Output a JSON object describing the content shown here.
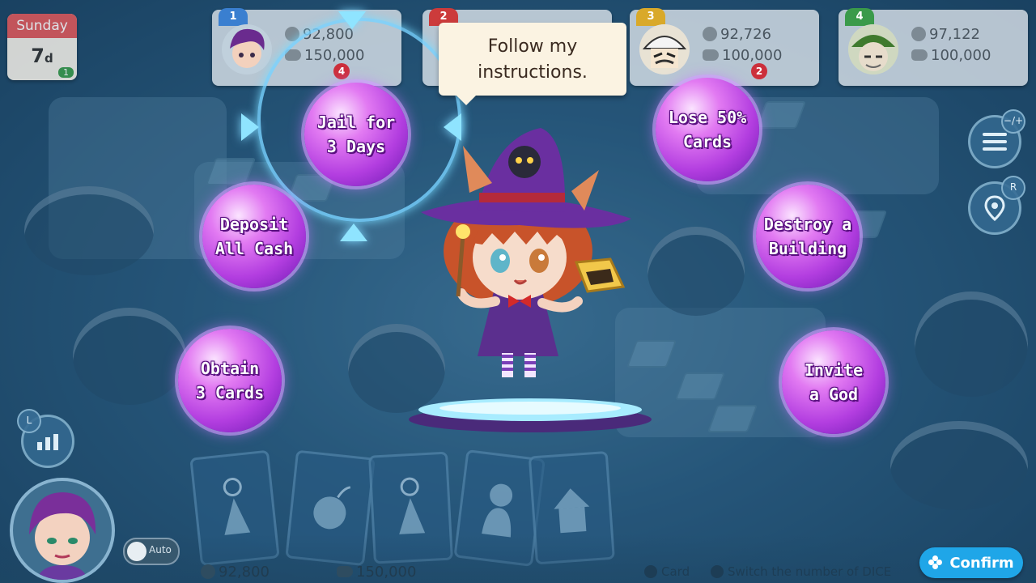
{
  "day": {
    "name": "Sunday",
    "number": "7",
    "unit": "d",
    "badge": "1"
  },
  "players": [
    {
      "rank": "1",
      "cash": "92,800",
      "assets": "150,000",
      "rank_color": "#3a7fd0",
      "dice": "4"
    },
    {
      "rank": "2",
      "cash": "",
      "assets": "",
      "rank_color": "#cc3b3b"
    },
    {
      "rank": "3",
      "cash": "92,726",
      "assets": "100,000",
      "rank_color": "#d9a92a",
      "dice": "2"
    },
    {
      "rank": "4",
      "cash": "97,122",
      "assets": "100,000",
      "rank_color": "#3a9a4a"
    }
  ],
  "speech": {
    "line1": "Follow my",
    "line2": "instructions."
  },
  "options": [
    {
      "id": "jail",
      "line1": "Jail for",
      "line2": "3 Days",
      "selected": true
    },
    {
      "id": "deposit",
      "line1": "Deposit",
      "line2": "All Cash"
    },
    {
      "id": "obtain",
      "line1": "Obtain",
      "line2": "3 Cards"
    },
    {
      "id": "lose",
      "line1": "Lose 50%",
      "line2": "Cards"
    },
    {
      "id": "destroy",
      "line1": "Destroy a",
      "line2": "Building"
    },
    {
      "id": "invite",
      "line1": "Invite",
      "line2": "a God"
    }
  ],
  "side_buttons": {
    "menu_tag": "−/+",
    "map_tag": "R",
    "stats_tag": "L"
  },
  "bottom": {
    "auto_label": "Auto",
    "cash": "92,800",
    "assets": "150,000",
    "hint_card": "Card",
    "hint_dice": "Switch the number of DICE",
    "confirm": "Confirm"
  },
  "colors": {
    "orb": "#b33ee0",
    "confirm": "#1fa6e8",
    "accent_ring": "#8fe4ff"
  },
  "icons": [
    "coin-icon",
    "piggy-bank-icon",
    "dice-icon",
    "menu-icon",
    "map-pin-icon",
    "stats-icon",
    "gamepad-icon"
  ]
}
